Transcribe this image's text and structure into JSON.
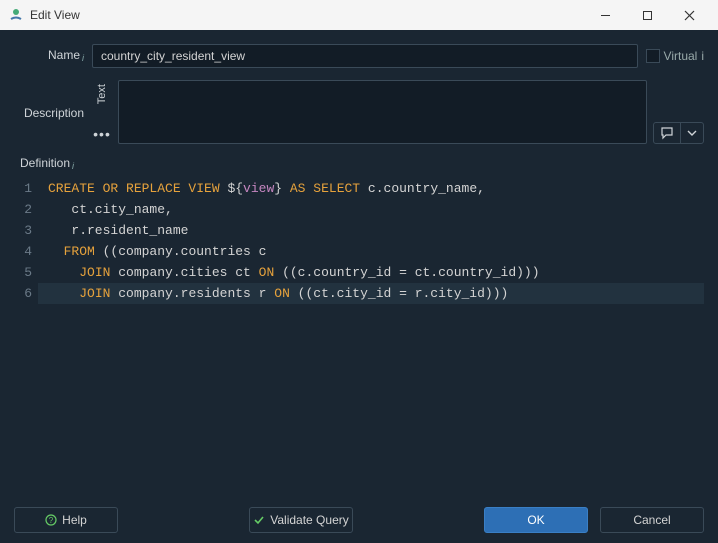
{
  "window": {
    "title": "Edit View"
  },
  "labels": {
    "name": "Name",
    "virtual": "Virtual",
    "description": "Description",
    "text_tab": "Text",
    "definition": "Definition"
  },
  "fields": {
    "name_value": "country_city_resident_view"
  },
  "sql": {
    "lines": [
      [
        {
          "cls": "kw0",
          "t": "CREATE OR REPLACE VIEW"
        },
        {
          "cls": "plain",
          "t": " ${"
        },
        {
          "cls": "var",
          "t": "view"
        },
        {
          "cls": "plain",
          "t": "} "
        },
        {
          "cls": "kw1",
          "t": "AS"
        },
        {
          "cls": "plain",
          "t": " "
        },
        {
          "cls": "kw1",
          "t": "SELECT"
        },
        {
          "cls": "plain",
          "t": " c.country_name,"
        }
      ],
      [
        {
          "cls": "plain",
          "t": "   ct.city_name,"
        }
      ],
      [
        {
          "cls": "plain",
          "t": "   r.resident_name"
        }
      ],
      [
        {
          "cls": "plain",
          "t": "  "
        },
        {
          "cls": "kw1",
          "t": "FROM"
        },
        {
          "cls": "plain",
          "t": " ((company.countries c"
        }
      ],
      [
        {
          "cls": "plain",
          "t": "    "
        },
        {
          "cls": "kw1",
          "t": "JOIN"
        },
        {
          "cls": "plain",
          "t": " company.cities ct "
        },
        {
          "cls": "kw1",
          "t": "ON"
        },
        {
          "cls": "plain",
          "t": " ((c.country_id = ct.country_id)))"
        }
      ],
      [
        {
          "cls": "plain",
          "t": "    "
        },
        {
          "cls": "kw1",
          "t": "JOIN"
        },
        {
          "cls": "plain",
          "t": " company.residents r "
        },
        {
          "cls": "kw1",
          "t": "ON"
        },
        {
          "cls": "plain",
          "t": " ((ct.city_id = r.city_id)))"
        }
      ]
    ],
    "highlight_line": 6
  },
  "buttons": {
    "help": "Help",
    "validate": "Validate Query",
    "ok": "OK",
    "cancel": "Cancel"
  }
}
